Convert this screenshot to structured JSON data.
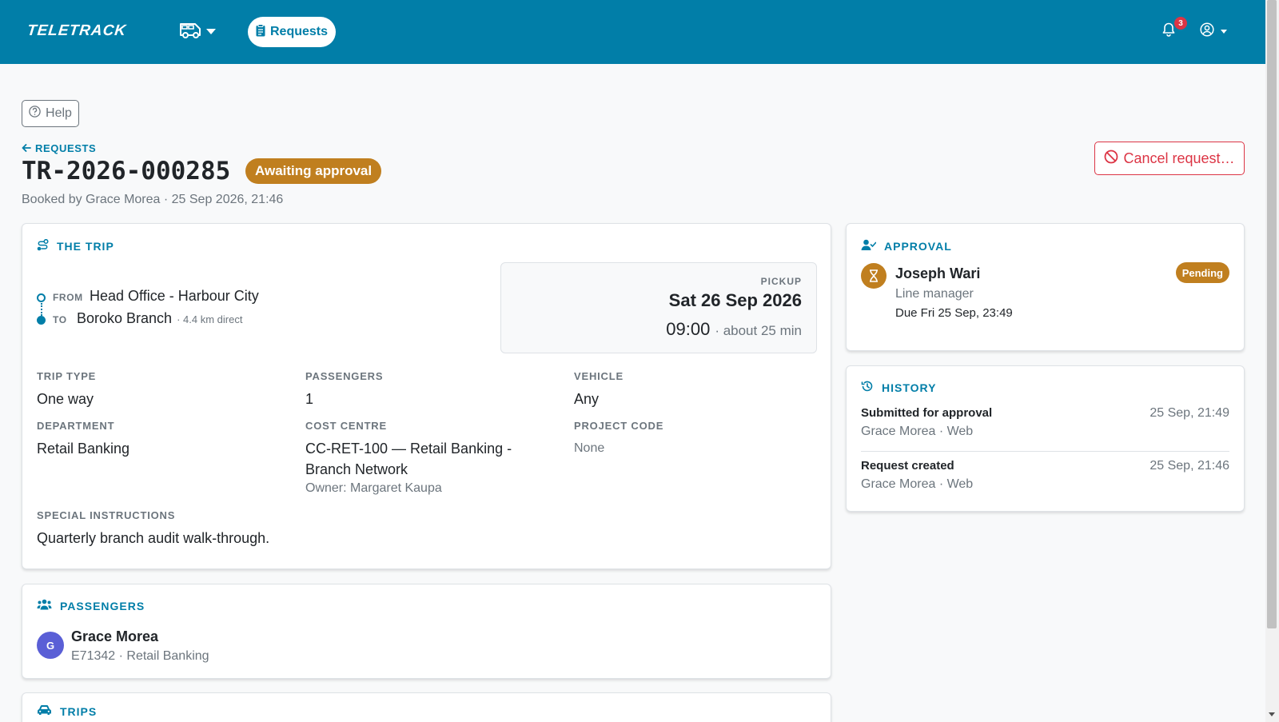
{
  "app": {
    "logo": "TELETRACK",
    "nav_requests": "Requests",
    "notification_count": "3",
    "brand_color": "#017ea8"
  },
  "header": {
    "help": "Help",
    "back": "REQUESTS",
    "request_id": "TR-2026-000285",
    "status": "Awaiting approval",
    "booked_by": "Booked by Grace Morea · 25 Sep 2026, 21:46",
    "cancel": "Cancel request…"
  },
  "trip": {
    "title": "THE TRIP",
    "from_label": "FROM",
    "from": "Head Office - Harbour City",
    "to_label": "TO",
    "to": "Boroko Branch",
    "distance": "· 4.4 km direct",
    "pickup_label": "PICKUP",
    "pickup_date": "Sat 26 Sep 2026",
    "pickup_time": "09:00",
    "pickup_duration": "· about 25 min",
    "fields": {
      "trip_type_label": "TRIP TYPE",
      "trip_type": "One way",
      "passengers_label": "PASSENGERS",
      "passengers": "1",
      "vehicle_label": "VEHICLE",
      "vehicle": "Any",
      "department_label": "DEPARTMENT",
      "department": "Retail Banking",
      "cost_centre_label": "COST CENTRE",
      "cost_centre": "CC-RET-100 — Retail Banking - Branch Network",
      "cost_centre_owner": "Owner: Margaret Kaupa",
      "project_code_label": "PROJECT CODE",
      "project_code": "None",
      "special_label": "SPECIAL INSTRUCTIONS",
      "special": "Quarterly branch audit walk-through."
    }
  },
  "approval": {
    "title": "APPROVAL",
    "approver": "Joseph Wari",
    "role": "Line manager",
    "due": "Due Fri 25 Sep, 23:49",
    "status": "Pending"
  },
  "history": {
    "title": "HISTORY",
    "items": [
      {
        "title": "Submitted for approval",
        "time": "25 Sep, 21:49",
        "sub": "Grace Morea · Web"
      },
      {
        "title": "Request created",
        "time": "25 Sep, 21:46",
        "sub": "Grace Morea · Web"
      }
    ]
  },
  "passengers": {
    "title": "PASSENGERS",
    "list": [
      {
        "initial": "G",
        "name": "Grace Morea",
        "sub": "E71342 · Retail Banking"
      }
    ]
  },
  "trips": {
    "title": "TRIPS"
  }
}
